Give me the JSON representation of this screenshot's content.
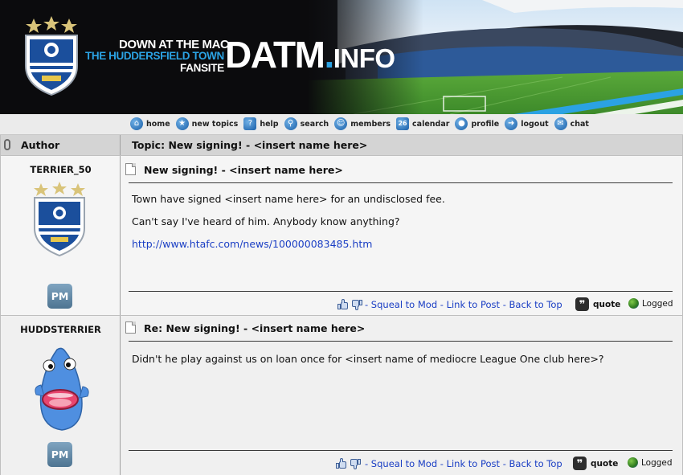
{
  "banner": {
    "line1": "DOWN AT THE MAC",
    "line2": "THE HUDDERSFIELD TOWN",
    "line3": "FANSITE",
    "logo_main": "DATM",
    "logo_dot": ".",
    "logo_suffix": "INFO",
    "brand_blue": "#2ba2e3"
  },
  "nav": {
    "items": [
      {
        "label": "home",
        "icon": "home-icon"
      },
      {
        "label": "new topics",
        "icon": "star-icon"
      },
      {
        "label": "help",
        "icon": "help-icon"
      },
      {
        "label": "search",
        "icon": "search-icon"
      },
      {
        "label": "members",
        "icon": "members-icon"
      },
      {
        "label": "calendar",
        "icon": "calendar-icon"
      },
      {
        "label": "profile",
        "icon": "profile-icon"
      },
      {
        "label": "logout",
        "icon": "logout-icon"
      },
      {
        "label": "chat",
        "icon": "chat-icon"
      }
    ]
  },
  "thread": {
    "author_header": "Author",
    "topic_header": "Topic: New signing! - <insert name here>"
  },
  "posts": [
    {
      "author": "TERRIER_50",
      "title": "New signing! - <insert name here>",
      "lines": [
        "Town have signed <insert name here> for an undisclosed fee.",
        "Can't say I've heard of him. Anybody know anything?"
      ],
      "link": "http://www.htafc.com/news/100000083485.htm",
      "pm_label": "PM",
      "footer_links": "- Squeal to Mod - Link to Post - Back to Top",
      "quote_label": "quote",
      "logged_label": "Logged"
    },
    {
      "author": "HUDDSTERRIER",
      "title": "Re: New signing! - <insert name here>",
      "lines": [
        "Didn't he play against us on loan once for <insert name of mediocre League One club here>?"
      ],
      "pm_label": "PM",
      "footer_links": "- Squeal to Mod - Link to Post - Back to Top",
      "quote_label": "quote",
      "logged_label": "Logged"
    }
  ]
}
